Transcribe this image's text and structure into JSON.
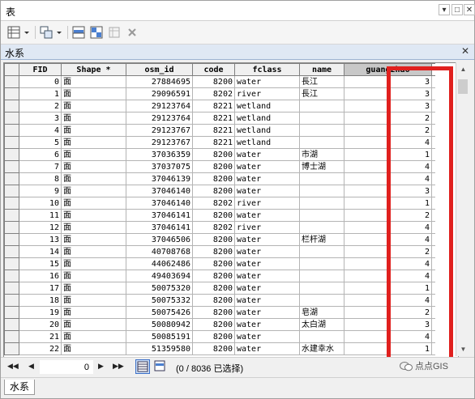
{
  "window": {
    "title": "表",
    "controls": [
      "▾",
      "□",
      "✕"
    ]
  },
  "toolbar": {
    "icons": [
      "table-options-icon",
      "related-tables-icon",
      "select-by-attributes-icon",
      "switch-selection-icon",
      "clear-selection-icon",
      "delete-selected-icon"
    ]
  },
  "layer": {
    "name": "水系",
    "close": "✕"
  },
  "table": {
    "columns": [
      "FID",
      "Shape *",
      "osm_id",
      "code",
      "fclass",
      "name",
      "guangzhao"
    ],
    "rows": [
      [
        "0",
        "面",
        "27884695",
        "8200",
        "water",
        "長江",
        "3"
      ],
      [
        "1",
        "面",
        "29096591",
        "8202",
        "river",
        "長江",
        "3"
      ],
      [
        "2",
        "面",
        "29123764",
        "8221",
        "wetland",
        "",
        "3"
      ],
      [
        "3",
        "面",
        "29123764",
        "8221",
        "wetland",
        "",
        "2"
      ],
      [
        "4",
        "面",
        "29123767",
        "8221",
        "wetland",
        "",
        "2"
      ],
      [
        "5",
        "面",
        "29123767",
        "8221",
        "wetland",
        "",
        "4"
      ],
      [
        "6",
        "面",
        "37036359",
        "8200",
        "water",
        "市湖",
        "1"
      ],
      [
        "7",
        "面",
        "37037075",
        "8200",
        "water",
        "博士湖",
        "4"
      ],
      [
        "8",
        "面",
        "37046139",
        "8200",
        "water",
        "",
        "4"
      ],
      [
        "9",
        "面",
        "37046140",
        "8200",
        "water",
        "",
        "3"
      ],
      [
        "10",
        "面",
        "37046140",
        "8202",
        "river",
        "",
        "1"
      ],
      [
        "11",
        "面",
        "37046141",
        "8200",
        "water",
        "",
        "2"
      ],
      [
        "12",
        "面",
        "37046141",
        "8202",
        "river",
        "",
        "4"
      ],
      [
        "13",
        "面",
        "37046506",
        "8200",
        "water",
        "栏杆湖",
        "4"
      ],
      [
        "14",
        "面",
        "40708768",
        "8200",
        "water",
        "",
        "2"
      ],
      [
        "15",
        "面",
        "44062486",
        "8200",
        "water",
        "",
        "4"
      ],
      [
        "16",
        "面",
        "49403694",
        "8200",
        "water",
        "",
        "4"
      ],
      [
        "17",
        "面",
        "50075320",
        "8200",
        "water",
        "",
        "1"
      ],
      [
        "18",
        "面",
        "50075332",
        "8200",
        "water",
        "",
        "4"
      ],
      [
        "19",
        "面",
        "50075426",
        "8200",
        "water",
        "皂湖",
        "2"
      ],
      [
        "20",
        "面",
        "50080942",
        "8200",
        "water",
        "太白湖",
        "3"
      ],
      [
        "21",
        "面",
        "50085191",
        "8200",
        "water",
        "",
        "4"
      ],
      [
        "22",
        "面",
        "51359580",
        "8200",
        "water",
        "水建幸水",
        "1"
      ]
    ]
  },
  "navigation": {
    "current_record": "0",
    "status": "(0 / 8036 已选择)",
    "first": "◀◀",
    "prev": "◀",
    "next": "▶",
    "last": "▶▶"
  },
  "watermark": "点点GIS",
  "bottom_tab": "水系",
  "colors": {
    "highlight": "#e0201e",
    "layerbar": "#dfe8f4"
  }
}
